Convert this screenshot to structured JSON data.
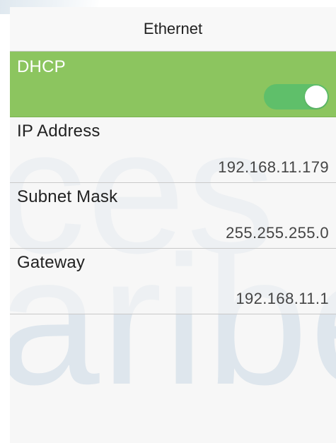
{
  "header": {
    "title": "Ethernet"
  },
  "dhcp": {
    "label": "DHCP",
    "enabled": true,
    "toggle_color": "#5fbf6a",
    "row_color": "#8cc55f"
  },
  "ip_address": {
    "label": "IP Address",
    "value": "192.168.11.179"
  },
  "subnet_mask": {
    "label": "Subnet Mask",
    "value": "255.255.255.0"
  },
  "gateway": {
    "label": "Gateway",
    "value": "192.168.11.1"
  },
  "watermark": {
    "line1": "ces",
    "line2": "aribe"
  }
}
